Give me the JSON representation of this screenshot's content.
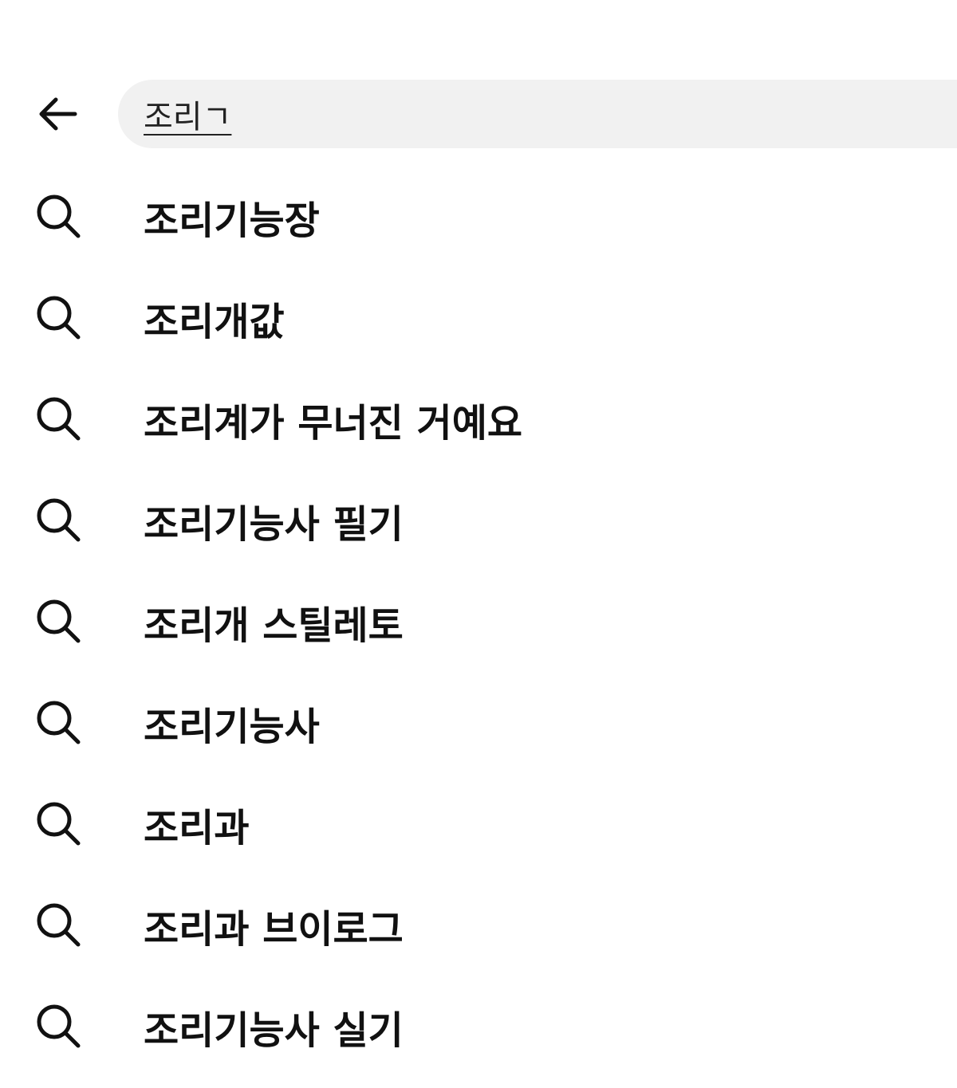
{
  "search": {
    "value": "조리ㄱ"
  },
  "icons": {
    "back": "arrow-left-icon",
    "suggestion": "search-icon"
  },
  "suggestions": [
    "조리기능장",
    "조리개값",
    "조리계가 무너진 거예요",
    "조리기능사 필기",
    "조리개 스틸레토",
    "조리기능사",
    "조리과",
    "조리과 브이로그",
    "조리기능사 실기"
  ]
}
